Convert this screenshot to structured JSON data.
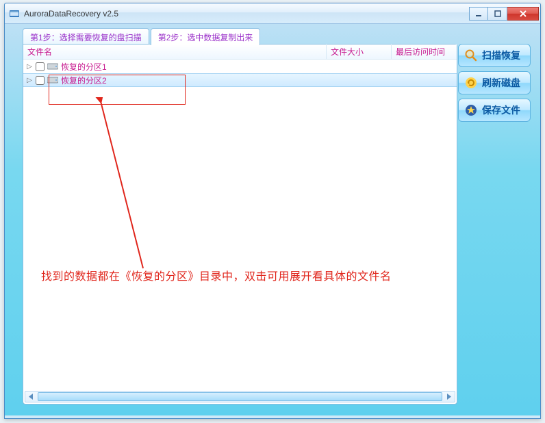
{
  "window": {
    "title": "AuroraDataRecovery v2.5"
  },
  "tabs": [
    {
      "label": "第1步：选择需要恢复的盘扫描",
      "active": false
    },
    {
      "label": "第2步：选中数据复制出来",
      "active": true
    }
  ],
  "columns": {
    "name": "文件名",
    "size": "文件大小",
    "time": "最后访问时间"
  },
  "rows": [
    {
      "label": "恢复的分区1",
      "selected": false
    },
    {
      "label": "恢复的分区2",
      "selected": true
    }
  ],
  "annotation": "找到的数据都在《恢复的分区》目录中，双击可用展开看具体的文件名",
  "side_buttons": {
    "scan": "扫描恢复",
    "refresh": "刷新磁盘",
    "save": "保存文件"
  }
}
